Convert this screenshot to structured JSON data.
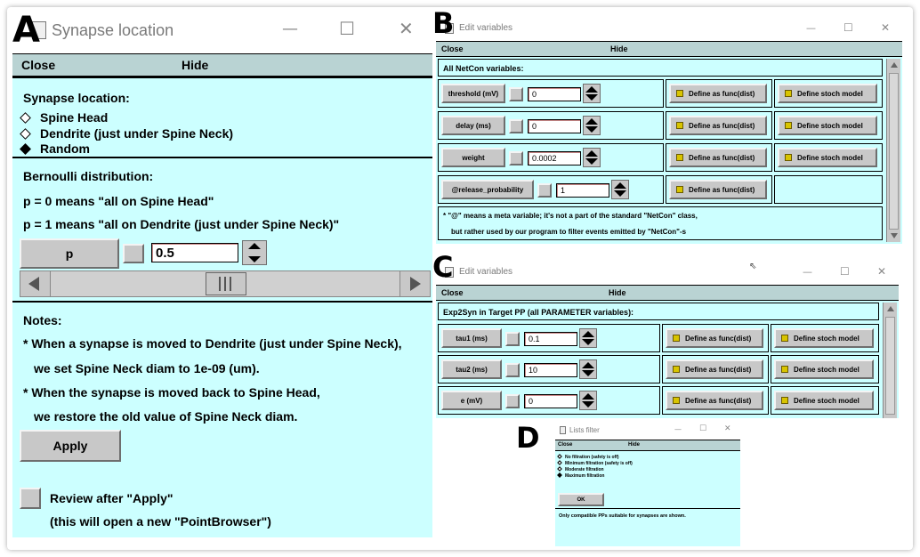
{
  "panel_labels": {
    "a": "A",
    "b": "B",
    "c": "C",
    "d": "D"
  },
  "window_a": {
    "title": "Synapse location",
    "menu": {
      "close": "Close",
      "hide": "Hide"
    },
    "synapse_location": {
      "heading": "Synapse location:",
      "options": [
        {
          "label": "Spine Head",
          "selected": false
        },
        {
          "label": "Dendrite (just under Spine Neck)",
          "selected": false
        },
        {
          "label": "Random",
          "selected": true
        }
      ]
    },
    "bernoulli": {
      "heading": "Bernoulli distribution:",
      "line1": "p = 0 means \"all on Spine Head\"",
      "line2": "p = 1 means \"all on Dendrite (just under Spine Neck)\"",
      "p_label": "p",
      "p_value": "0.5",
      "slider_fraction": 0.5
    },
    "notes": {
      "heading": "Notes:",
      "line1": "* When a synapse is moved to Dendrite (just under Spine Neck),",
      "line2": "we set Spine Neck diam to 1e-09 (um).",
      "line3": "* When the synapse is moved back to Spine Head,",
      "line4": "we restore the old value of Spine Neck diam.",
      "apply": "Apply"
    },
    "review": {
      "label": "Review after \"Apply\"",
      "sub": "(this will open a new \"PointBrowser\")"
    }
  },
  "window_b": {
    "title": "Edit variables",
    "menu": {
      "close": "Close",
      "hide": "Hide"
    },
    "section_title": "All NetCon variables:",
    "rows": [
      {
        "name": "threshold (mV)",
        "value": "0",
        "func": "Define as func(dist)",
        "stoch": "Define stoch model"
      },
      {
        "name": "delay (ms)",
        "value": "0",
        "func": "Define as func(dist)",
        "stoch": "Define stoch model"
      },
      {
        "name": "weight",
        "value": "0.0002",
        "func": "Define as func(dist)",
        "stoch": "Define stoch model"
      },
      {
        "name": "@release_probability",
        "value": "1",
        "func": "Define as func(dist)",
        "stoch": ""
      }
    ],
    "footnote1": "* \"@\" means a meta variable; it's not a part of the standard \"NetCon\" class,",
    "footnote2": "but rather used by our program to filter events emitted by \"NetCon\"-s"
  },
  "window_c": {
    "title": "Edit variables",
    "menu": {
      "close": "Close",
      "hide": "Hide"
    },
    "section_title": "Exp2Syn in Target PP (all PARAMETER variables):",
    "rows": [
      {
        "name": "tau1 (ms)",
        "value": "0.1",
        "func": "Define as func(dist)",
        "stoch": "Define stoch model"
      },
      {
        "name": "tau2 (ms)",
        "value": "10",
        "func": "Define as func(dist)",
        "stoch": "Define stoch model"
      },
      {
        "name": "e (mV)",
        "value": "0",
        "func": "Define as func(dist)",
        "stoch": "Define stoch model"
      }
    ]
  },
  "window_d": {
    "title": "Lists filter",
    "menu": {
      "close": "Close",
      "hide": "Hide"
    },
    "options": [
      {
        "label": "No filtration (safety is off)",
        "selected": false
      },
      {
        "label": "Minimum filtration (safety is off)",
        "selected": false
      },
      {
        "label": "Moderate filtration",
        "selected": false
      },
      {
        "label": "Maximum filtration",
        "selected": true
      }
    ],
    "ok": "OK",
    "note": "Only compatible PPs suitable for synapses are shown."
  },
  "window_controls": {
    "minimize": "—",
    "maximize": "☐",
    "close": "✕"
  },
  "colors": {
    "panel_bg": "#ccffff",
    "menubar_bg": "#b9d3d3",
    "button_bg": "#c8c8c8",
    "checkbox": "#d8c400"
  }
}
